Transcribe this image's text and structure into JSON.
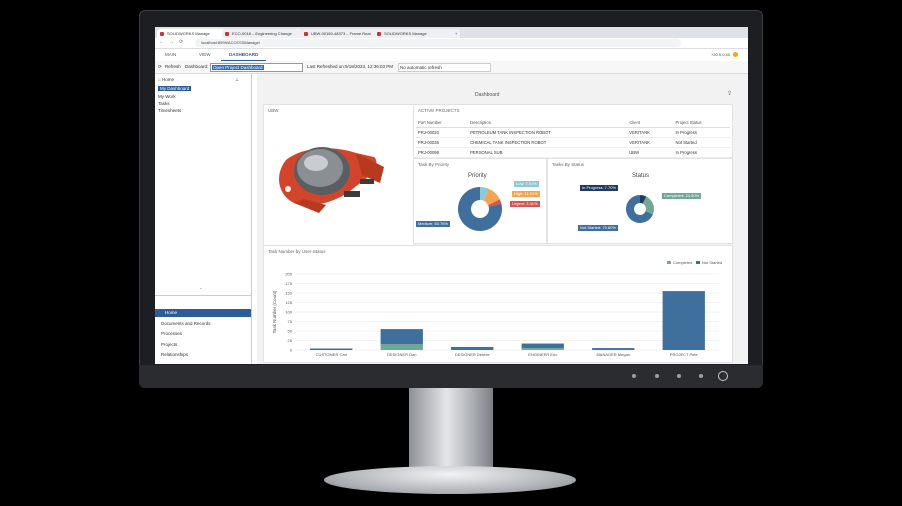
{
  "browser": {
    "tabs": [
      {
        "title": "SOLIDWORKS Manage"
      },
      {
        "title": "ECO-0018 – Engineering Change"
      },
      {
        "title": "UBW-00165-48373 – Frame Rear"
      },
      {
        "title": "SOLIDWORKS Manage"
      }
    ],
    "new_tab": "+",
    "url": "localhost:8999/ACCESSManage/",
    "back_icon": "←",
    "forward_icon": "→",
    "refresh_icon": "⟳"
  },
  "app_nav": {
    "items": [
      "MAIN",
      "VIEW",
      "DASHBOARD"
    ],
    "user": "+20.0.0.40"
  },
  "toolbar": {
    "refresh_label": "Refresh",
    "dashboard_label": "Dashboard:",
    "dashboard_value": "Open Project Dashboard",
    "last_refreshed_label": "Last Refreshed on:",
    "last_refreshed_value": "9/18/2023, 12:36:03 PM",
    "auto_refresh": "No automatic refresh"
  },
  "left_tree": {
    "home": "Home",
    "items": [
      "My Dashboard",
      "My Work",
      "Tasks",
      "Timesheets"
    ]
  },
  "left_nav": [
    "Home",
    "Documents and Records",
    "Processes",
    "Projects",
    "Relationships"
  ],
  "dashboard": {
    "title": "Dashboard",
    "image_panel_title": "UBW",
    "projects_title": "ACTIVE PROJECTS",
    "projects_columns": [
      "Part Number",
      "Description",
      "Client",
      "Project Status"
    ],
    "projects_rows": [
      [
        "PRJ-00020",
        "PETROLEUM TANK INSPECTION ROBOT",
        "VERITANK",
        "In Progress"
      ],
      [
        "PRJ-00035",
        "CHEMICAL TANK INSPECTION ROBOT",
        "VERITANK",
        "Not Started"
      ],
      [
        "PRJ-00098",
        "PERSONAL SUB",
        "UBW",
        "In Progress"
      ]
    ],
    "priority_panel_title": "Task By Priority",
    "priority_chart_title": "Priority",
    "priority_labels": [
      "Low: 7.01%",
      "High: 11.91%",
      "Urgent: 3.41%",
      "Medium: 83.76%"
    ],
    "status_panel_title": "Tasks By Status",
    "status_chart_title": "Status",
    "status_labels": [
      "In Progress: 7.70%",
      "Completed: 24.50%",
      "Not Started: 70.80%"
    ],
    "bar_panel_title": "Task Number by User-Status",
    "colors": {
      "completed": "#6fa894",
      "not_started": "#3f6f9d",
      "low": "#8fc9d6",
      "high": "#f5a452",
      "urgent": "#d9534f",
      "medium": "#3f6f9d",
      "in_progress": "#1f3b63"
    }
  },
  "chart_data": [
    {
      "type": "pie",
      "title": "Priority",
      "labels": [
        "Low",
        "High",
        "Urgent",
        "Medium"
      ],
      "values": [
        7.01,
        11.91,
        3.41,
        83.76
      ]
    },
    {
      "type": "pie",
      "title": "Status",
      "labels": [
        "In Progress",
        "Completed",
        "Not Started"
      ],
      "values": [
        7.7,
        24.5,
        70.8
      ]
    },
    {
      "type": "bar",
      "title": "Task Number by User-Status",
      "ylabel": "Task Number (Count)",
      "categories": [
        "CUSTOMER Carl",
        "DESIGNER Dan",
        "DESIGNER Debbie",
        "ENGINEER Eric",
        "MANAGER Megan",
        "PROJECT Pete"
      ],
      "series": [
        {
          "name": "Completed",
          "values": [
            0,
            15,
            0,
            5,
            0,
            0
          ]
        },
        {
          "name": "Not Started",
          "values": [
            4,
            40,
            8,
            12,
            5,
            155
          ]
        }
      ],
      "ylim": [
        0,
        200
      ],
      "yticks": [
        0,
        25,
        50,
        75,
        100,
        125,
        150,
        175,
        200
      ],
      "stacked": true,
      "legend": "top-right"
    }
  ]
}
